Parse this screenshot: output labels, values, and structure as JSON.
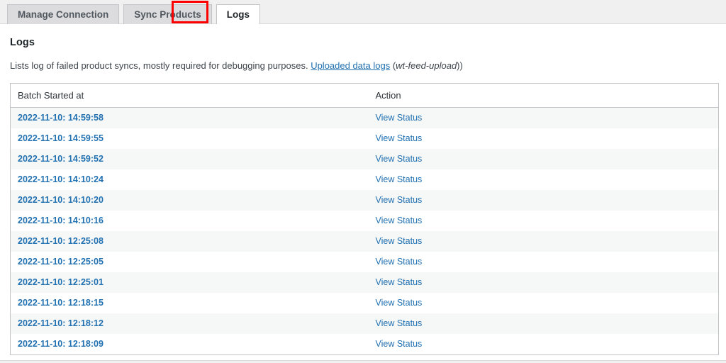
{
  "tabs": [
    {
      "label": "Manage Connection",
      "active": false
    },
    {
      "label": "Sync Products",
      "active": false
    },
    {
      "label": "Logs",
      "active": true
    }
  ],
  "page": {
    "title": "Logs",
    "description_before": "Lists log of failed product syncs, mostly required for debugging purposes. ",
    "description_link": "Uploaded data logs",
    "description_paren_open": " (",
    "description_italic": "wt-feed-upload",
    "description_after": "))"
  },
  "table": {
    "columns": [
      "Batch Started at",
      "Action"
    ],
    "action_label": "View Status",
    "rows": [
      {
        "batch_started_at": "2022-11-10: 14:59:58",
        "action": "View Status"
      },
      {
        "batch_started_at": "2022-11-10: 14:59:55",
        "action": "View Status"
      },
      {
        "batch_started_at": "2022-11-10: 14:59:52",
        "action": "View Status"
      },
      {
        "batch_started_at": "2022-11-10: 14:10:24",
        "action": "View Status"
      },
      {
        "batch_started_at": "2022-11-10: 14:10:20",
        "action": "View Status"
      },
      {
        "batch_started_at": "2022-11-10: 14:10:16",
        "action": "View Status"
      },
      {
        "batch_started_at": "2022-11-10: 12:25:08",
        "action": "View Status"
      },
      {
        "batch_started_at": "2022-11-10: 12:25:05",
        "action": "View Status"
      },
      {
        "batch_started_at": "2022-11-10: 12:25:01",
        "action": "View Status"
      },
      {
        "batch_started_at": "2022-11-10: 12:18:15",
        "action": "View Status"
      },
      {
        "batch_started_at": "2022-11-10: 12:18:12",
        "action": "View Status"
      },
      {
        "batch_started_at": "2022-11-10: 12:18:09",
        "action": "View Status"
      }
    ]
  },
  "colors": {
    "link": "#2271b1",
    "annotation": "#fe0000",
    "tab_bar_bg": "#f0f0f1",
    "tab_inactive_bg": "#dcdcde",
    "row_stripe": "#f6f7f7",
    "border": "#c3c4c7"
  }
}
